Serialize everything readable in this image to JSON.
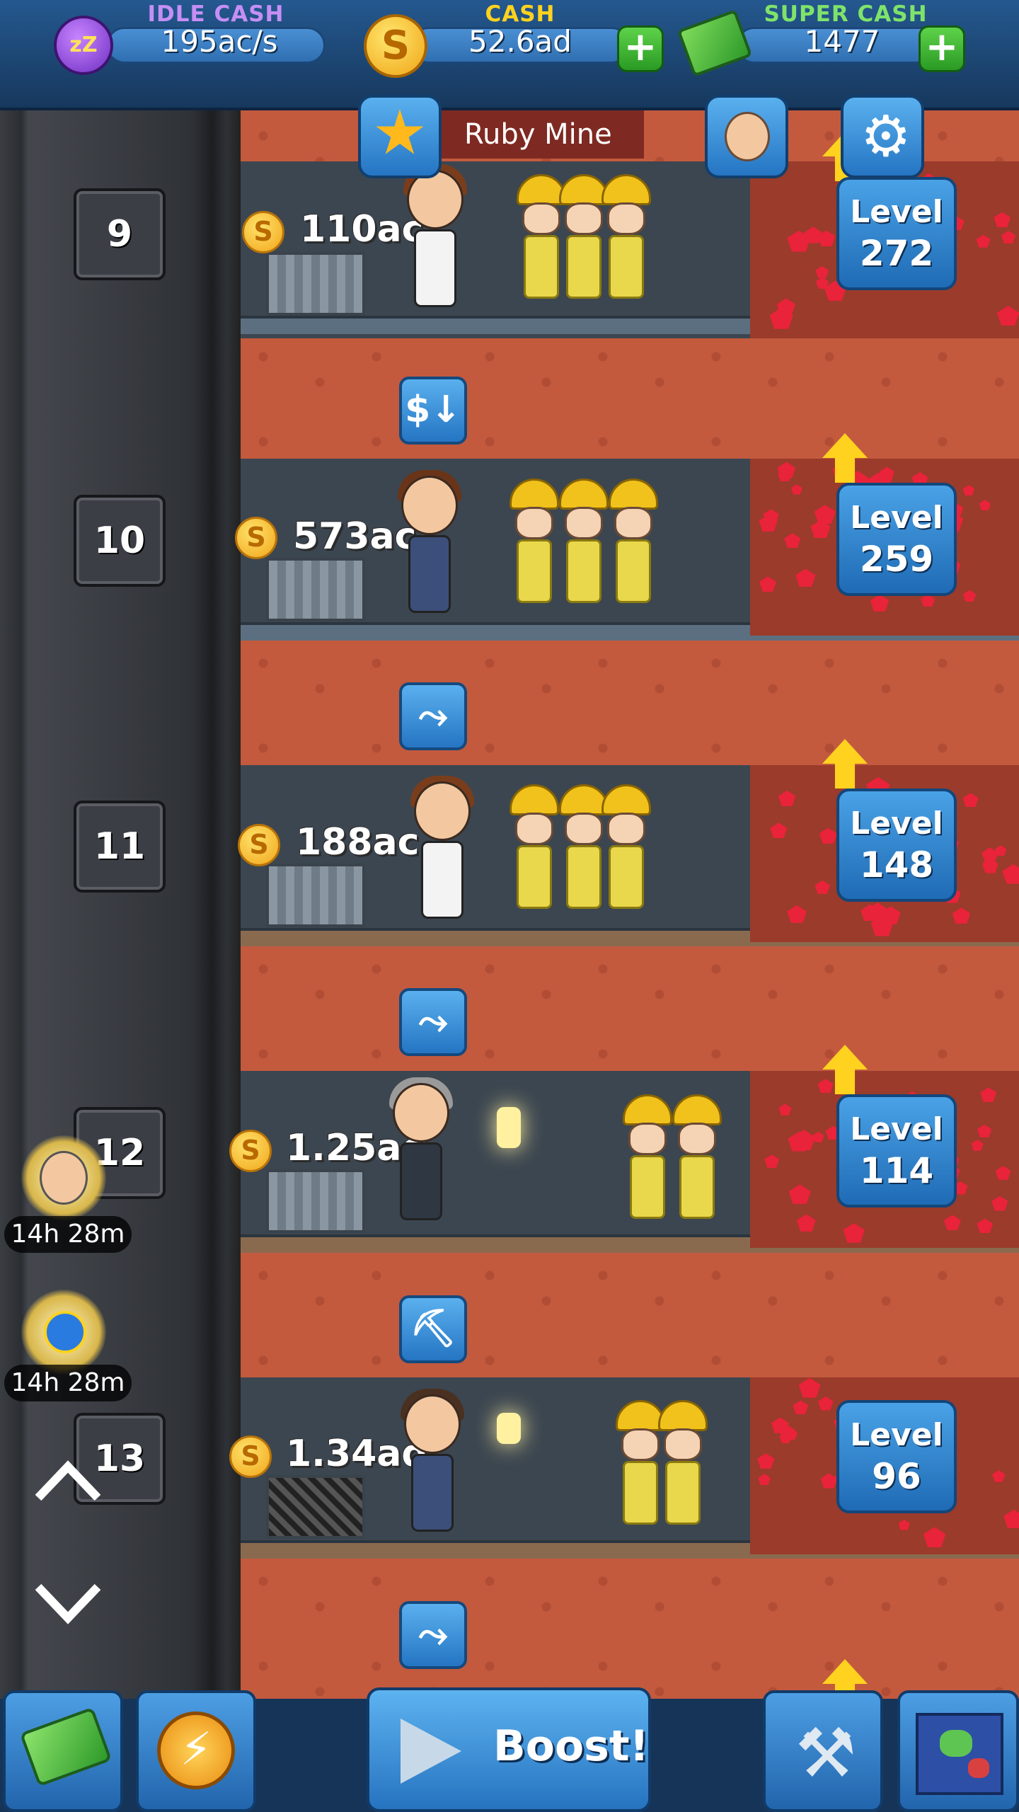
{
  "topbar": {
    "idle_cash": {
      "label": "IDLE CASH",
      "value": "195ac/s",
      "icon": "zzz-sleep-icon"
    },
    "cash": {
      "label": "CASH",
      "value": "52.6ad",
      "icon": "gold-coin-icon"
    },
    "super_cash": {
      "label": "SUPER CASH",
      "value": "1477",
      "icon": "super-cash-bills-icon"
    },
    "colors": {
      "idle_label": "#c58ff5",
      "cash_label": "#ffd21f",
      "super_label": "#7fe36a"
    }
  },
  "mine": {
    "title": "Ruby Mine"
  },
  "shafts": [
    {
      "number": "9",
      "cash": "110ac",
      "level_label": "Level",
      "level": "272"
    },
    {
      "number": "10",
      "cash": "573ac",
      "level_label": "Level",
      "level": "259"
    },
    {
      "number": "11",
      "cash": "188ac",
      "level_label": "Level",
      "level": "148"
    },
    {
      "number": "12",
      "cash": "1.25ad",
      "level_label": "Level",
      "level": "114"
    },
    {
      "number": "13",
      "cash": "1.34ad",
      "level_label": "Level",
      "level": "96"
    }
  ],
  "timers": [
    {
      "text": "14h 28m",
      "icon": "manager-portrait-icon"
    },
    {
      "text": "14h 28m",
      "icon": "boost-clock-icon"
    }
  ],
  "bottombar": {
    "boost_label": "Boost!"
  }
}
